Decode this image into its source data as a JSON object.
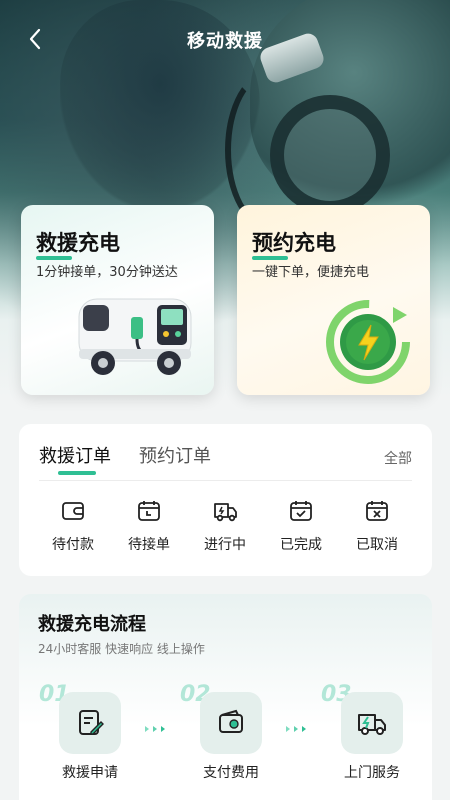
{
  "header": {
    "title": "移动救援"
  },
  "services": {
    "rescue": {
      "name": "救援充电",
      "desc": "1分钟接单，30分钟送达"
    },
    "reserve": {
      "name": "预约充电",
      "desc": "一键下单，便捷充电"
    }
  },
  "orders": {
    "tabs": [
      {
        "label": "救援订单"
      },
      {
        "label": "预约订单"
      }
    ],
    "active_tab": "救援订单",
    "all_label": "全部",
    "statuses": [
      {
        "label": "待付款",
        "icon": "wallet-icon"
      },
      {
        "label": "待接单",
        "icon": "calendar-icon"
      },
      {
        "label": "进行中",
        "icon": "truck-icon"
      },
      {
        "label": "已完成",
        "icon": "calendar-check-icon"
      },
      {
        "label": "已取消",
        "icon": "calendar-x-icon"
      }
    ]
  },
  "process": {
    "title": "救援充电流程",
    "subtitle": "24小时客服  快速响应  线上操作",
    "steps": [
      {
        "num": "01",
        "label": "救援申请",
        "icon": "form-edit-icon"
      },
      {
        "num": "02",
        "label": "支付费用",
        "icon": "wallet-icon"
      },
      {
        "num": "03",
        "label": "上门服务",
        "icon": "delivery-truck-icon"
      }
    ]
  },
  "colors": {
    "accent": "#2fbf94",
    "lightning": "#f6d21d",
    "badge_green": "#3aa84a"
  }
}
